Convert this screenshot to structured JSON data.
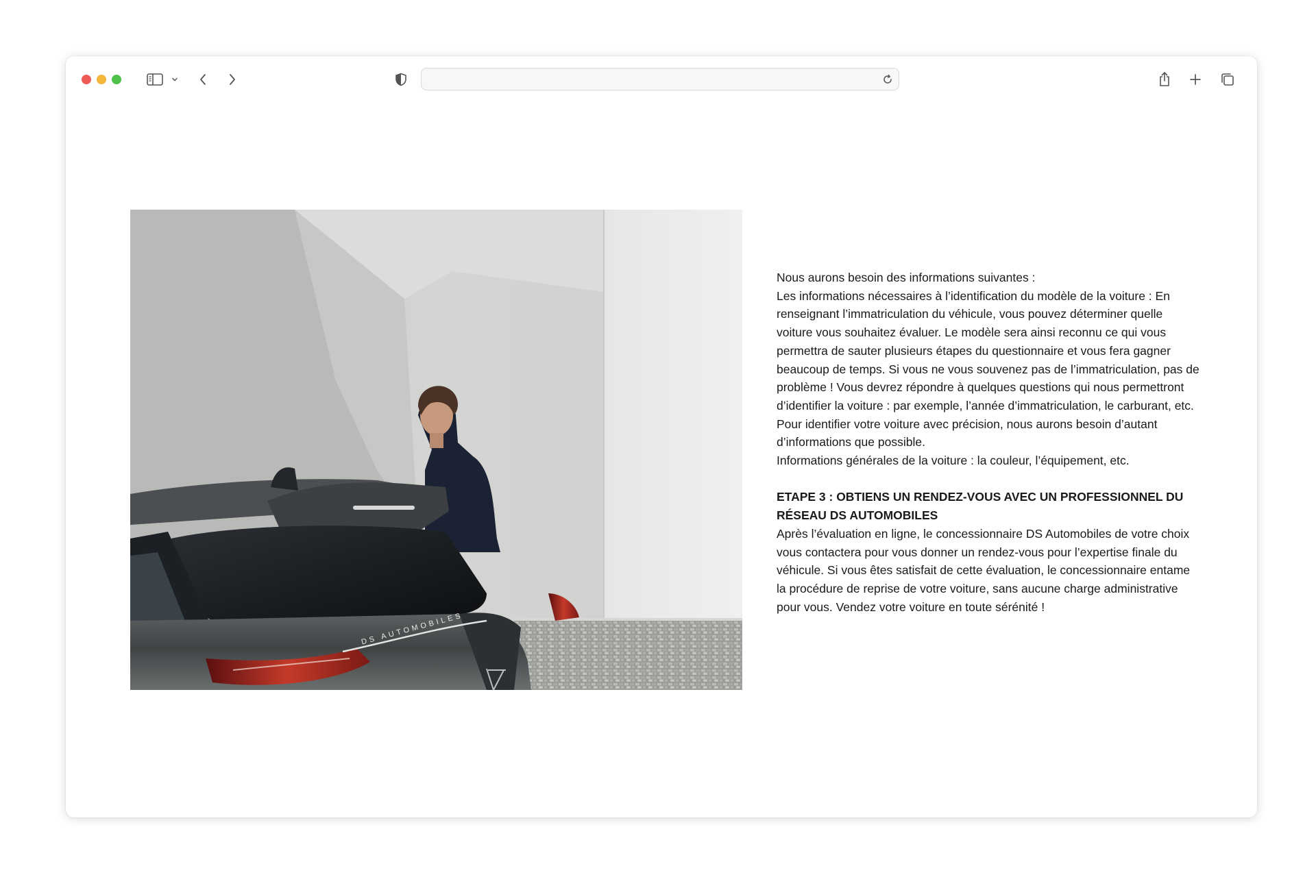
{
  "browser": {
    "address_value": "",
    "address_placeholder": ""
  },
  "icons": {
    "sidebar": "sidebar-icon",
    "sidebar_menu": "chevron-down-icon",
    "back": "chevron-left-icon",
    "forward": "chevron-right-icon",
    "privacy": "shield-icon",
    "reload": "reload-icon",
    "share": "share-icon",
    "new_tab": "plus-icon",
    "tabs": "tab-overview-icon"
  },
  "colors": {
    "close": "#ee5b56",
    "minimize": "#f3b73a",
    "zoom": "#4fc04a",
    "text": "#1a1a1a"
  },
  "hero": {
    "car_badge_text": "DS AUTOMOBILES"
  },
  "article": {
    "intro": "Nous aurons besoin des informations suivantes :",
    "identification": "Les informations nécessaires à l’identification du modèle de la voiture : En renseignant l’immatriculation du véhicule, vous pouvez déterminer quelle voiture vous souhaitez évaluer. Le modèle sera ainsi reconnu ce qui vous permettra de sauter plusieurs étapes du questionnaire et vous fera gagner beaucoup de temps. Si vous ne vous souvenez pas de l’immatriculation, pas de problème ! Vous devrez répondre à quelques questions qui nous permettront d’identifier la voiture : par exemple, l’année d’immatriculation, le carburant, etc. Pour identifier votre voiture avec précision, nous aurons besoin d’autant d’informations que possible.",
    "general_info": "Informations générales de la voiture : la couleur, l’équipement, etc.",
    "step3_title": "ETAPE 3 : OBTIENS UN RENDEZ-VOUS AVEC UN PROFESSIONNEL DU RÉSEAU DS AUTOMOBILES",
    "step3_body": "Après l’évaluation en ligne, le concessionnaire DS Automobiles de votre choix vous contactera pour vous donner un rendez-vous pour l’expertise finale du véhicule. Si vous êtes satisfait de cette évaluation, le concessionnaire entame la procédure de reprise de votre voiture, sans aucune charge administrative pour vous. Vendez votre voiture en toute sérénité !"
  }
}
